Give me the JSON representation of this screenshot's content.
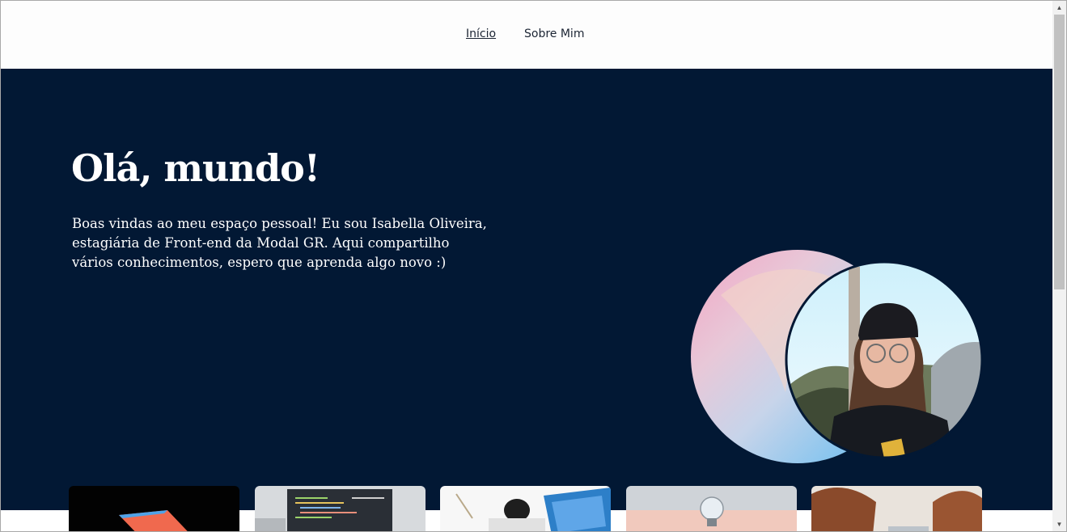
{
  "nav": {
    "items": [
      {
        "label": "Início",
        "active": true
      },
      {
        "label": "Sobre Mim",
        "active": false
      }
    ]
  },
  "hero": {
    "title": "Olá, mundo!",
    "text": "Boas vindas ao meu espaço pessoal! Eu sou Isabella Oliveira, estagiária de Front-end da Modal GR. Aqui compartilho vários conhecimentos, espero que aprenda algo novo :)"
  },
  "colors": {
    "hero_bg": "#021834",
    "nav_bg": "#fdfdfd",
    "text_light": "#ffffff",
    "nav_text": "#1b2433"
  },
  "cards": [
    {
      "icon": "laptop-photo-thumbnail"
    },
    {
      "icon": "code-screen-photo-thumbnail"
    },
    {
      "icon": "desk-workspace-photo-thumbnail"
    },
    {
      "icon": "lightbulb-photo-thumbnail"
    },
    {
      "icon": "people-laptop-photo-thumbnail"
    }
  ]
}
